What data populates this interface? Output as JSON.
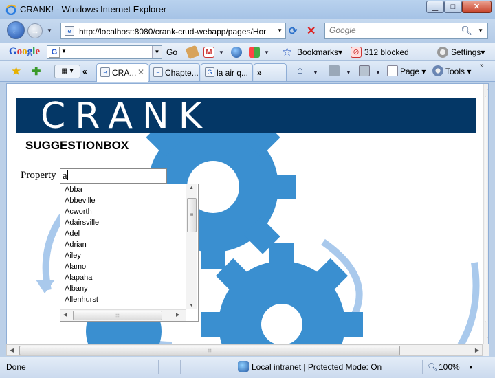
{
  "window": {
    "title": "CRANK! - Windows Internet Explorer",
    "min_label": "▁",
    "max_label": "□",
    "close_label": "✕"
  },
  "nav": {
    "url": "http://localhost:8080/crank-crud-webapp/pages/Hor",
    "search_placeholder": "Google"
  },
  "google_toolbar": {
    "go_label": "Go",
    "bookmarks_label": "Bookmarks▾",
    "blocked_label": "312 blocked",
    "settings_label": "Settings▾"
  },
  "tabs": [
    {
      "label": "CRA...",
      "active": true,
      "icon": "ie-page-icon"
    },
    {
      "label": "Chapte...",
      "active": false,
      "icon": "ie-page-icon"
    },
    {
      "label": "la air q...",
      "active": false,
      "icon": "google-icon"
    },
    {
      "label": "»",
      "active": false,
      "icon": ""
    }
  ],
  "commands": {
    "page_label": "Page ▾",
    "tools_label": "Tools ▾"
  },
  "page": {
    "brand": "CRANK",
    "subtitle": "SUGGESTIONBOX",
    "property_label": "Property",
    "property_value": "a",
    "suggestions": [
      "Abba",
      "Abbeville",
      "Acworth",
      "Adairsville",
      "Adel",
      "Adrian",
      "Ailey",
      "Alamo",
      "Alapaha",
      "Albany",
      "Allenhurst"
    ]
  },
  "status": {
    "text": "Done",
    "zone": "Local intranet | Protected Mode: On",
    "zoom": "100%"
  },
  "colors": {
    "banner": "#043766",
    "gear": "#3a8fd0",
    "arrow": "#a9c9ec"
  }
}
